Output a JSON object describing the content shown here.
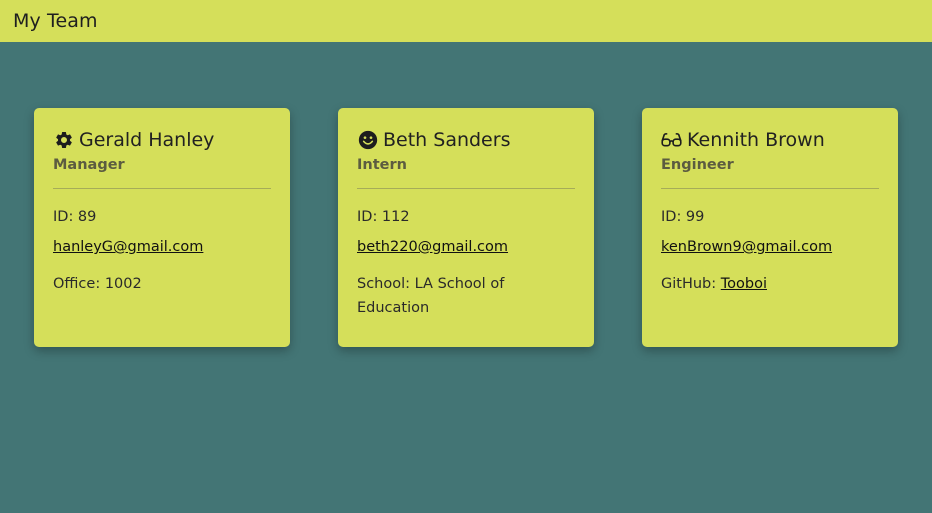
{
  "navbar": {
    "title": "My Team"
  },
  "employees": [
    {
      "name": "Gerald Hanley",
      "role": "Manager",
      "icon": "gear-icon",
      "id_label": "ID: 89",
      "email": "hanleyG@gmail.com",
      "extra_label": "Office: 1002"
    },
    {
      "name": "Beth Sanders",
      "role": "Intern",
      "icon": "smiley-icon",
      "id_label": "ID: 112",
      "email": "beth220@gmail.com",
      "extra_label": "School: LA School of Education"
    },
    {
      "name": "Kennith Brown",
      "role": "Engineer",
      "icon": "glasses-icon",
      "id_label": "ID: 99",
      "email": "kenBrown9@gmail.com",
      "extra_prefix": "GitHub: ",
      "github": "Tooboi"
    }
  ],
  "colors": {
    "background": "#437575",
    "accent": "#d5df5a"
  }
}
